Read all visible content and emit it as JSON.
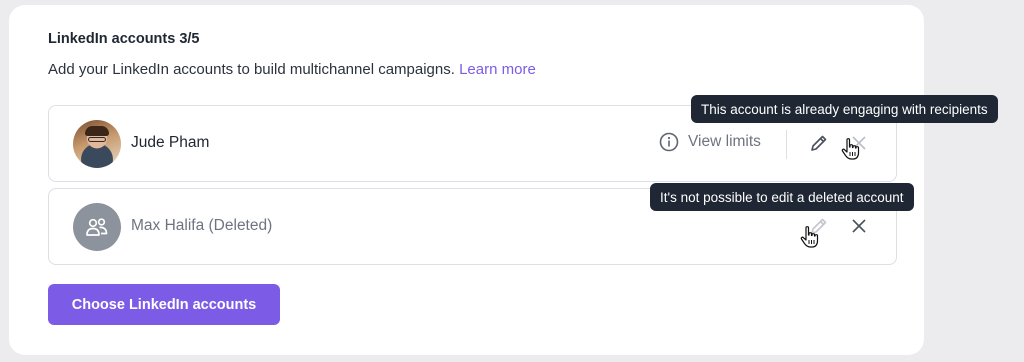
{
  "header": {
    "title": "LinkedIn accounts 3/5",
    "description": "Add your LinkedIn accounts to build multichannel campaigns.",
    "learn_more": "Learn more"
  },
  "accounts": [
    {
      "name": "Jude Pham",
      "view_limits_label": "View limits",
      "avatar": "profile-photo",
      "tooltip": "This account is already engaging with recipients"
    },
    {
      "name": "Max Halifa (Deleted)",
      "avatar": "people-icon",
      "tooltip": "It's not possible to edit a deleted account"
    }
  ],
  "actions": {
    "choose_label": "Choose LinkedIn accounts"
  },
  "colors": {
    "accent": "#7c5ce6",
    "tooltip_bg": "#1e2733",
    "background": "#ececee"
  }
}
